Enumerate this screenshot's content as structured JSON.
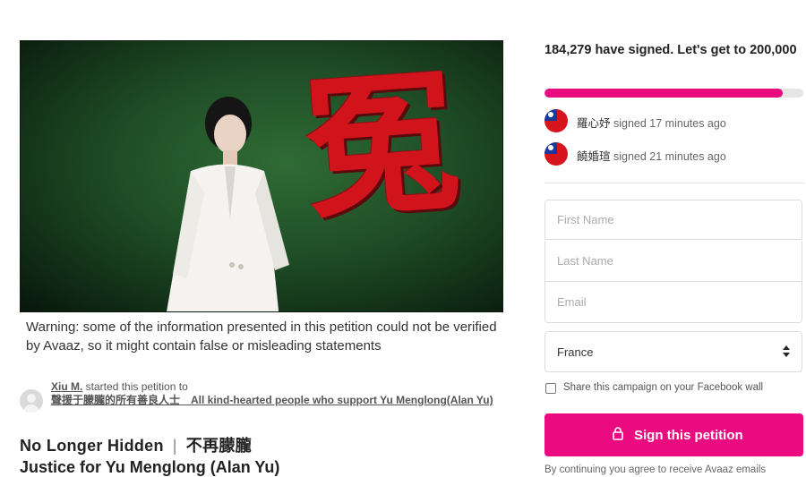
{
  "hero": {
    "glyph": "冤",
    "warning": "Warning: some of the information presented in this petition could not be verified by Avaaz, so it might contain false or misleading statements"
  },
  "starter": {
    "name": "Xiu M.",
    "action": " started this petition to",
    "target": "聲援于朦朧的所有善良人士　All kind-hearted people who support Yu Menglong(Alan Yu)"
  },
  "title": {
    "line1_en": "No Longer Hidden",
    "line1_sep": "|",
    "line1_zh": "不再朦朧",
    "line2": "Justice for Yu Menglong (Alan Yu)"
  },
  "sidebar": {
    "goal_text": "184,279 have signed. Let's get to 200,000",
    "progress_fraction": 0.92,
    "signers": [
      {
        "name": "羅心妤",
        "action": " signed 17 minutes ago"
      },
      {
        "name": "饒婚瑄",
        "action": " signed 21 minutes ago"
      }
    ],
    "form": {
      "first_name_placeholder": "First Name",
      "last_name_placeholder": "Last Name",
      "email_placeholder": "Email",
      "country": "France",
      "share_label": "Share this campaign on your Facebook wall",
      "sign_button": "Sign this petition",
      "consent": "By continuing you agree to receive Avaaz emails"
    }
  },
  "colors": {
    "accent": "#ec0a80",
    "hero_green": "#2f6b35",
    "glyph_red": "#d1141b"
  },
  "icons": [
    "user-avatar-icon",
    "taiwan-flag-icon",
    "select-arrows-icon",
    "lock-icon",
    "checkbox"
  ]
}
